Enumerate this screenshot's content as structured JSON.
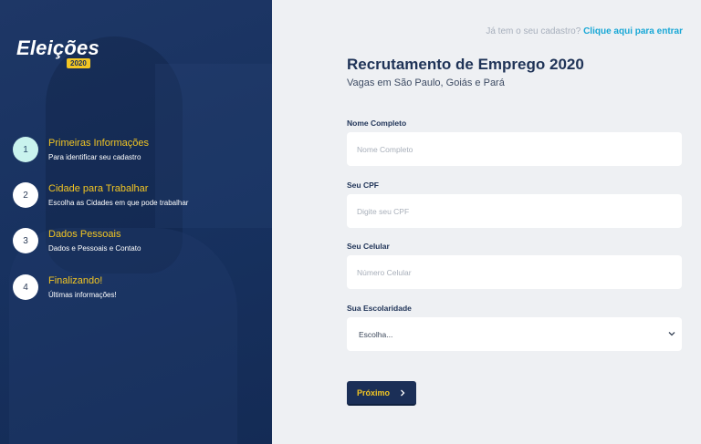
{
  "brand": {
    "title": "Eleições",
    "year": "2020"
  },
  "steps": [
    {
      "number": "1",
      "title": "Primeiras Informações",
      "subtitle": "Para identificar seu cadastro"
    },
    {
      "number": "2",
      "title": "Cidade para Trabalhar",
      "subtitle": "Escolha as Cidades em que pode trabalhar"
    },
    {
      "number": "3",
      "title": "Dados Pessoais",
      "subtitle": "Dados e Pessoais e Contato"
    },
    {
      "number": "4",
      "title": "Finalizando!",
      "subtitle": "Últimas informações!"
    }
  ],
  "login": {
    "question": "Já tem o seu cadastro?",
    "link": "Clique aqui para entrar"
  },
  "header": {
    "title": "Recrutamento de Emprego 2020",
    "subtitle": "Vagas em São Paulo, Goiás e Pará"
  },
  "form": {
    "name": {
      "label": "Nome Completo",
      "placeholder": "Nome Completo"
    },
    "cpf": {
      "label": "Seu CPF",
      "placeholder": "Digite seu CPF"
    },
    "phone": {
      "label": "Seu Celular",
      "placeholder": "Número Celular"
    },
    "education": {
      "label": "Sua Escolaridade",
      "selected": "Escolha..."
    },
    "next_label": "Próximo"
  },
  "colors": {
    "sidebar": "#1e3766",
    "accent": "#f3c623",
    "link": "#17a7d6",
    "active_step": "#c9f3ee"
  },
  "icons": {
    "next": "chevron-right-icon",
    "select": "chevron-down-icon"
  }
}
